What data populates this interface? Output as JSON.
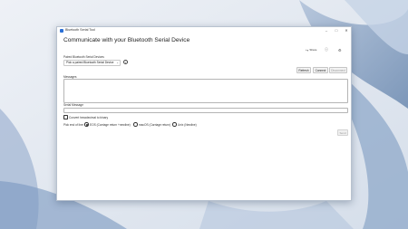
{
  "window": {
    "title": "Bluetooth Serial Tool",
    "minimize_icon": "minimize-icon",
    "maximize_icon": "maximize-icon",
    "close_icon": "close-icon"
  },
  "header": {
    "heading": "Communicate with your Bluetooth Serial Device"
  },
  "commands": {
    "share_label": "Share",
    "share_icon": "share-icon",
    "info_icon": "info-icon",
    "settings_icon": "gear-icon"
  },
  "device": {
    "label": "Paired Bluetooth Serial Devices",
    "selected": "Pick a paired Bluetooth Serial Device"
  },
  "actions": {
    "refresh": "Refresh",
    "connect": "Connect",
    "disconnect": "Disconnect"
  },
  "messages": {
    "label": "Messages",
    "value": ""
  },
  "serial": {
    "label": "Serial Message",
    "value": ""
  },
  "options": {
    "convert_label": "Convert hexadecimal to binary",
    "convert_checked": false,
    "eol_label": "Pick end of line:",
    "eol_options": [
      {
        "label": "EOS (Carriage return +newline)",
        "selected": true
      },
      {
        "label": "macOS (Carriage return)",
        "selected": false
      },
      {
        "label": "Unix (Newline)",
        "selected": false
      }
    ]
  },
  "send": {
    "label": "Send"
  },
  "colors": {
    "accent": "#2b6fd6",
    "window_bg": "#ffffff",
    "wallpaper": "#dfe6f1"
  }
}
